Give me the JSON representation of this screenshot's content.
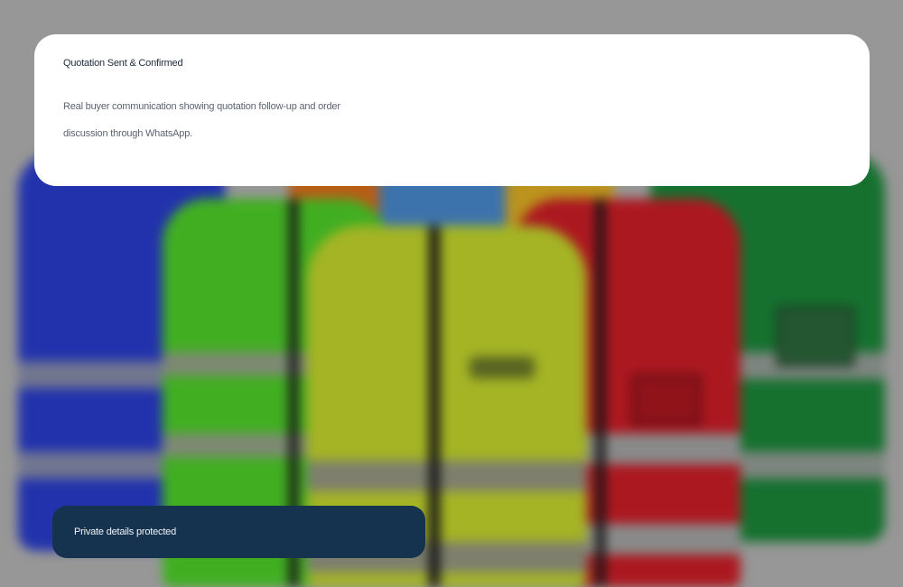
{
  "card": {
    "title": "Quotation Sent & Confirmed",
    "description": "Real buyer communication showing quotation follow-up and order discussion through WhatsApp."
  },
  "badge": {
    "text": "Private details protected"
  },
  "background": {
    "image": "safety-vests-photo",
    "vest_colors": [
      "#2b3fd0",
      "#4fd62a",
      "#c8dc2a",
      "#d8202a",
      "#1a8a3c",
      "#e06a1a",
      "#4a8fd0",
      "#e0b020"
    ]
  }
}
